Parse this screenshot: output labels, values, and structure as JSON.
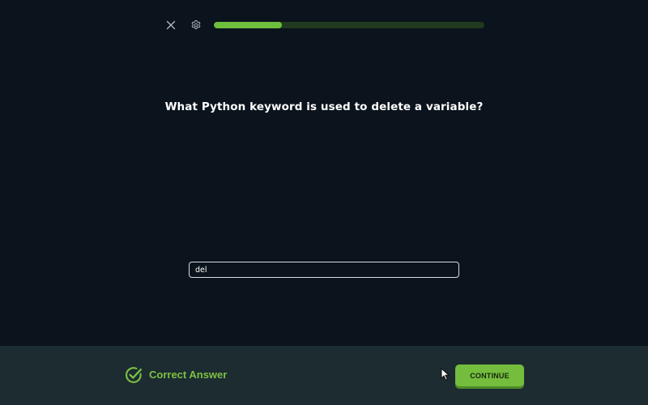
{
  "header": {
    "close_icon": "close-icon",
    "settings_icon": "gear-icon",
    "progress_percent": 25,
    "progress_colors": {
      "track": "#203a1e",
      "fill": "#6fbf3e"
    }
  },
  "quiz": {
    "question": "What Python keyword is used to delete a variable?",
    "answer_value": "del"
  },
  "feedback": {
    "status_icon": "check-circle-icon",
    "status_text": "Correct Answer",
    "status_color": "#7dc142",
    "continue_label": "CONTINUE",
    "continue_color": "#74bd3d",
    "cursor_icon": "mouse-pointer-icon"
  }
}
